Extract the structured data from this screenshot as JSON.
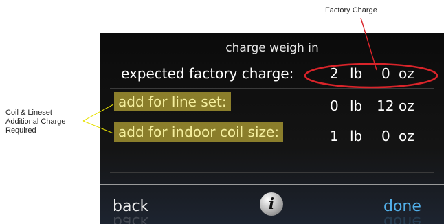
{
  "annotations": {
    "factory_charge": "Factory Charge",
    "coil_lineset": [
      "Coil & Lineset",
      "Additional Charge",
      "Required"
    ]
  },
  "screen": {
    "title": "charge weigh in",
    "rows": [
      {
        "label": "expected factory charge:",
        "lb_value": "2",
        "lb_unit": "lb",
        "oz_value": "0",
        "oz_unit": "oz"
      },
      {
        "label": "add for line set:",
        "lb_value": "0",
        "lb_unit": "lb",
        "oz_value": "12",
        "oz_unit": "oz"
      },
      {
        "label": "add for indoor coil size:",
        "lb_value": "1",
        "lb_unit": "lb",
        "oz_value": "0",
        "oz_unit": "oz"
      }
    ],
    "back_label": "back",
    "info_label": "i",
    "done_label": "done"
  },
  "colors": {
    "highlight": "#8b7e2b",
    "circle": "#d9242a",
    "done": "#52b0ea",
    "callout_line": "#e6e000"
  }
}
